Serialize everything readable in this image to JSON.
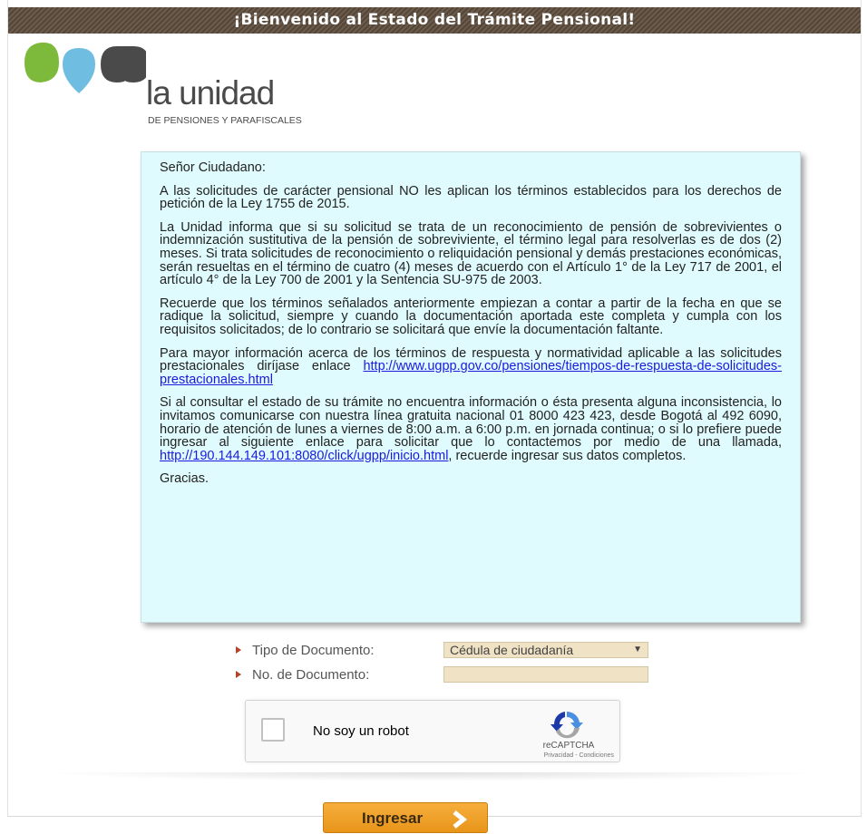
{
  "banner": {
    "title": "¡Bienvenido al Estado del Trámite Pensional!"
  },
  "logo": {
    "name": "la unidad",
    "subtitle": "DE PENSIONES Y PARAFISCALES"
  },
  "notice": {
    "greeting": "Señor Ciudadano:",
    "p1": "A las solicitudes de carácter pensional NO les aplican los términos establecidos para los derechos de petición de la Ley 1755 de 2015.",
    "p2": "La Unidad informa que si su solicitud se trata de un reconocimiento de pensión de sobrevivientes o indemnización sustitutiva de la pensión de sobreviviente, el término legal para resolverlas es de dos (2) meses. Si trata solicitudes de reconocimiento o reliquidación pensional y demás prestaciones económicas, serán resueltas en el término de cuatro (4) meses de acuerdo con el Artículo 1° de la Ley 717 de 2001, el artículo 4° de la Ley 700 de 2001 y la Sentencia SU-975 de 2003.",
    "p3": "Recuerde que los términos señalados anteriormente empiezan a contar a partir de la fecha en que se radique la solicitud, siempre y cuando la documentación aportada este completa y cumpla con los requisitos solicitados; de lo contrario se solicitará que envíe la documentación faltante.",
    "p4_text": "Para mayor información acerca de los términos de respuesta y normatividad aplicable a las solicitudes prestacionales diríjase enlace",
    "p4_link": "http://www.ugpp.gov.co/pensiones/tiempos-de-respuesta-de-solicitudes-prestacionales.html",
    "p5_text": "Si al consultar el estado de su trámite no encuentra información o ésta presenta alguna inconsistencia, lo invitamos comunicarse con nuestra línea gratuita nacional 01 8000 423 423, desde Bogotá al 492 6090, horario de atención de lunes a viernes de 8:00 a.m. a 6:00 p.m. en jornada continua; o si lo prefiere puede ingresar al siguiente enlace para solicitar que lo contactemos por medio de una llamada,",
    "p5_link": "http://190.144.149.101:8080/click/ugpp/inicio.html",
    "p5_tail": ", recuerde ingresar sus datos completos.",
    "closing": "Gracias."
  },
  "form": {
    "doc_type_label": "Tipo de Documento:",
    "doc_type_value": "Cédula de ciudadanía",
    "doc_number_label": "No. de Documento:",
    "doc_number_value": ""
  },
  "captcha": {
    "label": "No soy un robot",
    "brand": "reCAPTCHA",
    "links": "Privacidad - Condiciones"
  },
  "submit": {
    "label": "Ingresar"
  },
  "colors": {
    "banner": "#5a4a3a",
    "notice_bg": "#e0fbfd",
    "button": "#f0a32c",
    "link": "#1a1ae0",
    "field_bg": "#f0e2c4",
    "logo_green": "#7dba3c",
    "logo_blue": "#6fbde0",
    "logo_gray": "#4a4a4a"
  },
  "icons": {
    "captcha": "recaptcha-icon",
    "button": "chevron-right-icon",
    "bullet": "bullet-arrow-icon"
  }
}
